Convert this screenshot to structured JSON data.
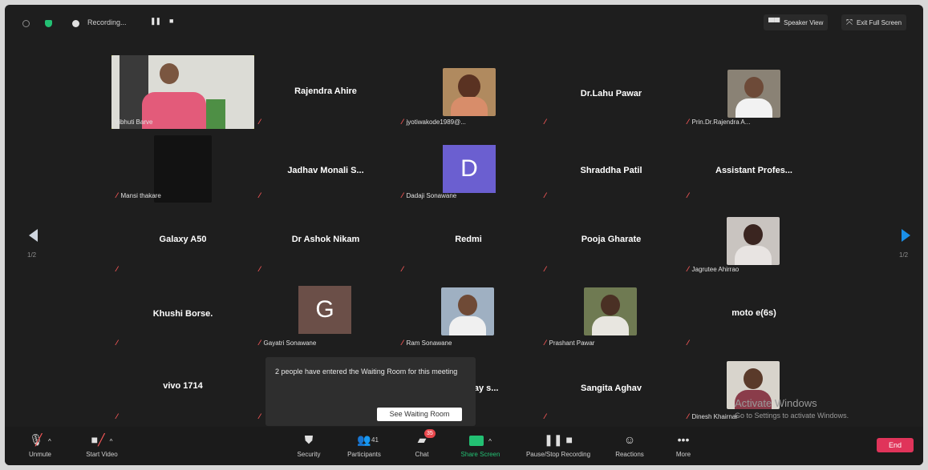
{
  "topbar": {
    "recording_label": "Recording...",
    "pause_glyph": "❚❚",
    "stop_glyph": "■",
    "speaker_view": "Speaker View",
    "exit_full_screen": "Exit Full Screen",
    "icons": [
      "info-icon",
      "shield-icon",
      "recording-dot-icon",
      "pause-icon",
      "stop-icon",
      "speaker-view-icon",
      "exit-fullscreen-icon"
    ]
  },
  "tiles": [
    {
      "id": "vibhuti",
      "label": "Vibhuti Barve",
      "type": "video"
    },
    {
      "id": "rajendra",
      "label": "Rajendra Ahire",
      "type": "name"
    },
    {
      "id": "jyoti",
      "label": "jyotiwakode1989@...",
      "type": "video"
    },
    {
      "id": "lahu",
      "label": "Dr.Lahu Pawar",
      "type": "name"
    },
    {
      "id": "prin",
      "label": "Prin.Dr.Rajendra A...",
      "type": "video"
    },
    {
      "id": "mansi",
      "label": "Mansi thakare",
      "type": "video"
    },
    {
      "id": "jadhav",
      "label": "Jadhav Monali S...",
      "type": "name"
    },
    {
      "id": "dadaji",
      "label": "Dadaji Sonawane",
      "type": "avatar",
      "letter": "D"
    },
    {
      "id": "shraddha",
      "label": "Shraddha Patil",
      "type": "name"
    },
    {
      "id": "assistant",
      "label": "Assistant Profes...",
      "type": "name"
    },
    {
      "id": "galaxy",
      "label": "Galaxy A50",
      "type": "name"
    },
    {
      "id": "ashok",
      "label": "Dr Ashok Nikam",
      "type": "name"
    },
    {
      "id": "redmi",
      "label": "Redmi",
      "type": "name"
    },
    {
      "id": "pooja",
      "label": "Pooja Gharate",
      "type": "name"
    },
    {
      "id": "jagrutee",
      "label": "Jagrutee Ahirrao",
      "type": "video"
    },
    {
      "id": "khushi",
      "label": "Khushi Borse.",
      "type": "name"
    },
    {
      "id": "gayatri",
      "label": "Gayatri Sonawane",
      "type": "avatar",
      "letter": "G"
    },
    {
      "id": "ram",
      "label": "Ram Sonawane",
      "type": "video"
    },
    {
      "id": "prashant",
      "label": "Prashant Pawar",
      "type": "video"
    },
    {
      "id": "moto",
      "label": "moto e(6s)",
      "type": "name"
    },
    {
      "id": "vivo",
      "label": "vivo 1714",
      "type": "name"
    },
    {
      "id": "sanjay",
      "label": "anjay s...",
      "type": "name"
    },
    {
      "id": "sangita",
      "label": "Sangita Aghav",
      "type": "name"
    },
    {
      "id": "dinesh",
      "label": "Dinesh Khairnar",
      "type": "video"
    }
  ],
  "avatar_colors": {
    "D": "#6b5fd0",
    "G": "#6b4f48"
  },
  "nav": {
    "left_page": "1/2",
    "right_page": "1/2"
  },
  "waiting_room": {
    "message": "2 people have entered the Waiting Room for this meeting",
    "button": "See Waiting Room"
  },
  "watermark": {
    "title": "Activate Windows",
    "subtitle": "Go to Settings to activate Windows."
  },
  "toolbar": {
    "unmute": "Unmute",
    "start_video": "Start Video",
    "security": "Security",
    "participants": "Participants",
    "participants_count": "41",
    "chat": "Chat",
    "chat_badge": "35",
    "share_screen": "Share Screen",
    "pause_stop_recording": "Pause/Stop Recording",
    "reactions": "Reactions",
    "more": "More",
    "end": "End"
  },
  "colors": {
    "share_accent": "#23c073",
    "end_button": "#e0345a",
    "active_speaker": "#d7e04a",
    "mute_red": "#ff5a5a"
  }
}
